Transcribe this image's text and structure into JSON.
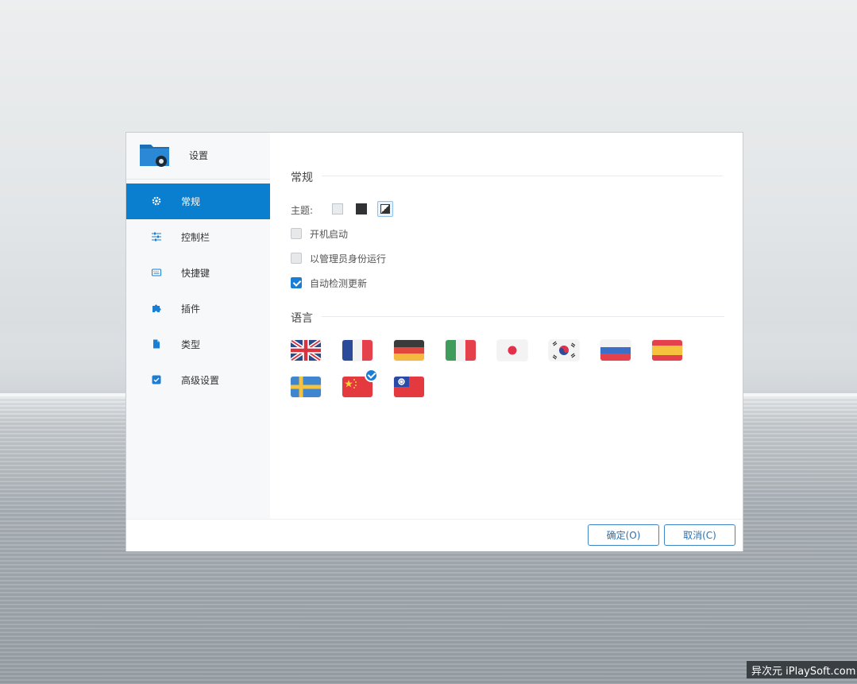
{
  "sidebar": {
    "title": "设置",
    "items": [
      {
        "label": "常规",
        "icon": "gear-icon",
        "active": true
      },
      {
        "label": "控制栏",
        "icon": "sliders-icon",
        "active": false
      },
      {
        "label": "快捷键",
        "icon": "keyboard-icon",
        "active": false
      },
      {
        "label": "插件",
        "icon": "puzzle-icon",
        "active": false
      },
      {
        "label": "类型",
        "icon": "file-type-icon",
        "active": false
      },
      {
        "label": "高级设置",
        "icon": "advanced-check-icon",
        "active": false
      }
    ]
  },
  "general": {
    "section_title": "常规",
    "theme_label": "主题:",
    "themes": [
      "light",
      "dark",
      "auto"
    ],
    "selected_theme": "auto",
    "options": [
      {
        "label": "开机启动",
        "checked": false
      },
      {
        "label": "以管理员身份运行",
        "checked": false
      },
      {
        "label": "自动检测更新",
        "checked": true
      }
    ]
  },
  "language": {
    "section_title": "语言",
    "flags": [
      "uk",
      "france",
      "germany",
      "italy",
      "japan",
      "korea",
      "russia",
      "spain",
      "sweden",
      "china",
      "taiwan"
    ],
    "selected": "china"
  },
  "footer": {
    "ok_label": "确定(O)",
    "cancel_label": "取消(C)"
  },
  "watermark": "异次元 iPlaySoft.com",
  "colors": {
    "accent": "#0a7fd0"
  }
}
